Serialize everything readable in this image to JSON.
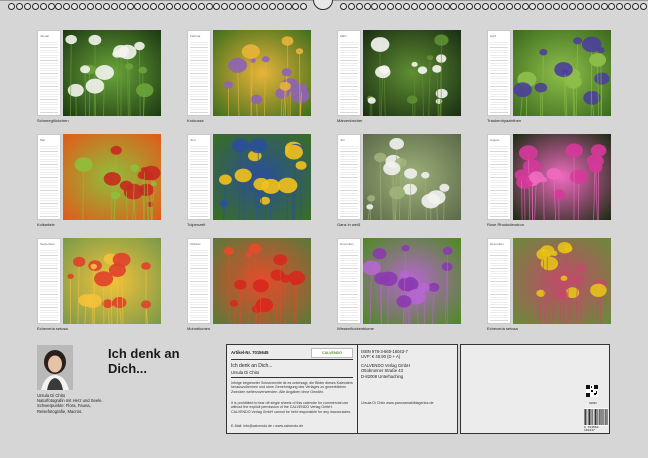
{
  "calendar": {
    "months": [
      {
        "month": "Januar",
        "caption": "Schneeglöckchen",
        "photo": "snowdrops",
        "colors": [
          "#1d3a12",
          "#f4f4ee",
          "#6aa53a"
        ]
      },
      {
        "month": "Februar",
        "caption": "Krokusse",
        "photo": "crocuses",
        "colors": [
          "#3e6e1c",
          "#8e63b5",
          "#e8b43a"
        ]
      },
      {
        "month": "März",
        "caption": "Märzenbecher",
        "photo": "snowflakes",
        "colors": [
          "#1a2e13",
          "#f7f7f2",
          "#5f8f33"
        ]
      },
      {
        "month": "April",
        "caption": "Traubenhyazinthen",
        "photo": "grape-hyacinths",
        "colors": [
          "#3b6a1e",
          "#4a3f9a",
          "#8fbf4a"
        ]
      },
      {
        "month": "Mai",
        "caption": "Kolkwitzie",
        "photo": "red-blossom",
        "colors": [
          "#e05a1a",
          "#c62a1f",
          "#8fbf3a"
        ]
      },
      {
        "month": "Juni",
        "caption": "Tulpenzeit",
        "photo": "tulips",
        "colors": [
          "#3a6e22",
          "#f2c21c",
          "#2a4f9a"
        ]
      },
      {
        "month": "Juli",
        "caption": "Ganz in weiß",
        "photo": "white-tulips",
        "colors": [
          "#5c6a4a",
          "#f2f2ee",
          "#9fb27a"
        ]
      },
      {
        "month": "August",
        "caption": "Rose Rhododendron",
        "photo": "rhododendron",
        "colors": [
          "#1c2b12",
          "#d6389a",
          "#f06ac0"
        ]
      },
      {
        "month": "September",
        "caption": "Echeveria setosa",
        "photo": "echeveria",
        "colors": [
          "#7a9a4a",
          "#e0402a",
          "#f4c23a"
        ]
      },
      {
        "month": "Oktober",
        "caption": "Mohnblumen",
        "photo": "poppies",
        "colors": [
          "#5a7a3a",
          "#d6281e",
          "#e84a2a"
        ]
      },
      {
        "month": "November",
        "caption": "Wiesenflockenblume",
        "photo": "knapweed",
        "colors": [
          "#4e8a22",
          "#8b3ab0",
          "#b766d0"
        ]
      },
      {
        "month": "Dezember",
        "caption": "Echeveria setosa",
        "photo": "yellow-flower",
        "colors": [
          "#6a8a3a",
          "#e6c21a",
          "#c24a6a"
        ]
      }
    ]
  },
  "author": {
    "name": "Ursula Di Chito",
    "description": "Naturfotografin mit Herz und Seele. Schwerpunkte: Flora, Fauna, Reisefotografie, Macros."
  },
  "title": {
    "line1": "Ich denk an",
    "line2": "Dich..."
  },
  "publisher": {
    "article_no": "Artikel-Nr. 7015645",
    "brand": "CALVENDO",
    "title_short": "Ich denk an Dich...",
    "author_short": "Ursula Di Chito",
    "legal_de": "Infolge begrenzter Schutzrechte ist es untersagt, die Bilder dieses Kalenders herauszutrennen und ohne Genehmigung des Verlages zu gewerblichen Zwecken weiterzuverwenden. Alle Angaben ohne Gewähr.",
    "legal_en": "It is prohibited to tear off single sheets of this calendar for commercial use without the explicit permission of the CALVENDO Verlag GmbH. CALVENDO Verlag GmbH cannot be held responsible for any inaccuracies.",
    "contact": "E-Mail: info@calvendo.de • www.calvendo.de",
    "isbn": "ISBN 978-3-660-16043-7",
    "price": "UVP: € 49,90 (D + A)",
    "company": "CALVENDO Verlag GmbH",
    "street": "Ottobrunner Straße 43",
    "city": "D-82008 Unterhaching",
    "credit": "Ursula Di Chito www.panoramabildagentur.de",
    "code": "04660",
    "barcode_number": "9 783660 160437"
  }
}
